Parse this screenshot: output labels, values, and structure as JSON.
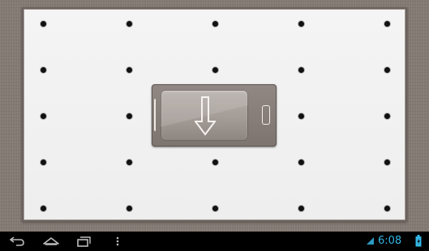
{
  "app": {
    "surface": "pin-grid-board",
    "center_icon": "phone-download-icon"
  },
  "statusbar": {
    "clock": "6:08",
    "accent_color": "#33b5e5",
    "icons": [
      "wifi-icon",
      "battery-charging-icon"
    ]
  },
  "navbar": {
    "buttons": [
      "back-icon",
      "home-icon",
      "recent-apps-icon",
      "menu-overflow-icon"
    ]
  },
  "colors": {
    "board": "#f0f0f0",
    "backdrop": "#847a74",
    "dot": "#111111"
  }
}
